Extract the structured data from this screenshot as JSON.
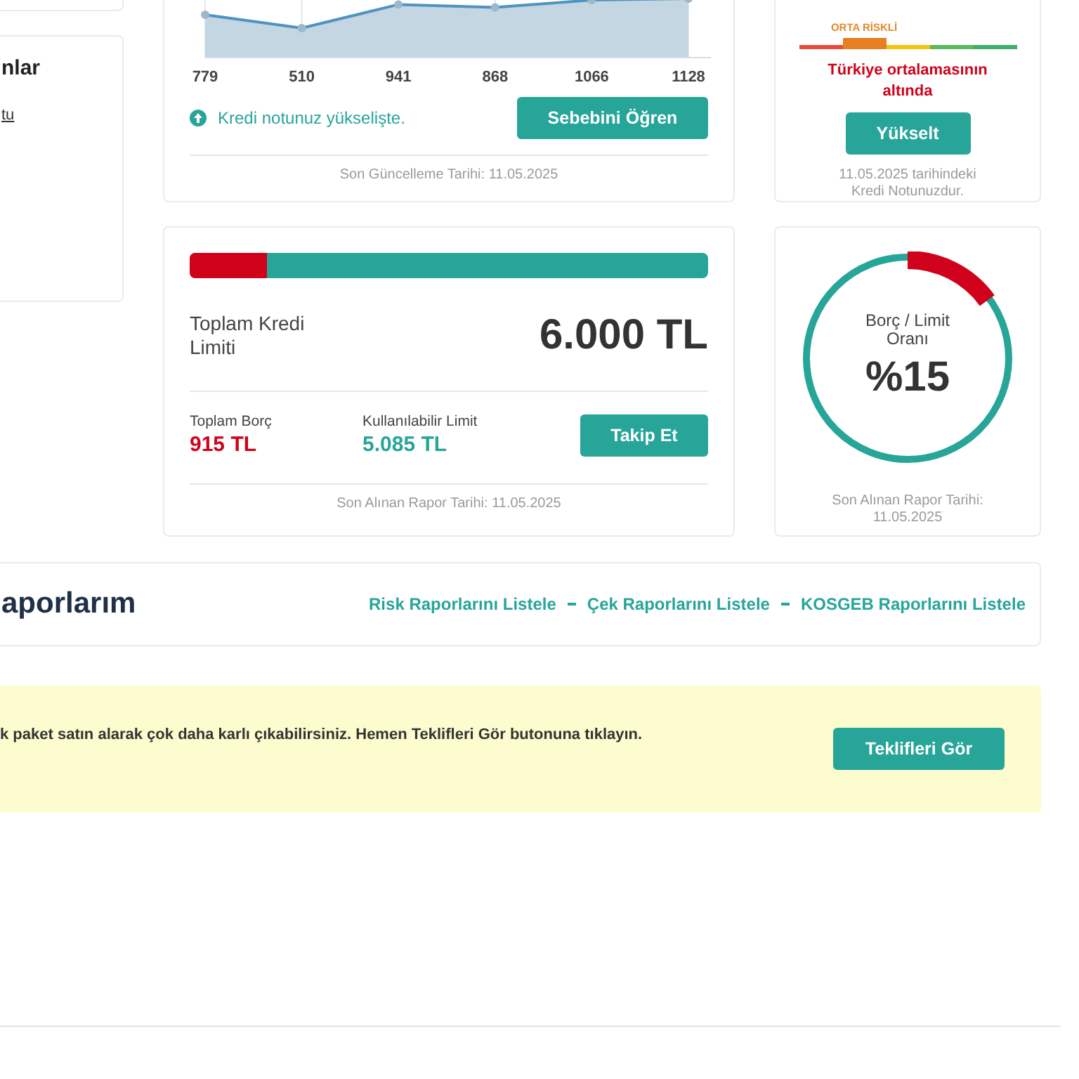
{
  "left_card": {
    "heading": "nlar",
    "link": "tu"
  },
  "score_chart": {
    "point_labels": [
      "779",
      "510",
      "941",
      "868",
      "1066",
      "1128"
    ],
    "trend": "Kredi notunuz yükselişte.",
    "button": "Sebebini Öğren",
    "footer": "Son Güncelleme Tarihi: 11.05.2025"
  },
  "score_card": {
    "risk_label": "ORTA RİSKLİ",
    "segments": [
      {
        "color": "#e74c3c",
        "selected": false
      },
      {
        "color": "#e67e22",
        "selected": true
      },
      {
        "color": "#f1c40f",
        "selected": false
      },
      {
        "color": "#5cb85c",
        "selected": false
      },
      {
        "color": "#3fae6a",
        "selected": false
      }
    ],
    "comparison": "Türkiye ortalamasının altında",
    "button": "Yükselt",
    "footer": "11.05.2025 tarihindeki Kredi Notunuzdur."
  },
  "limit_card": {
    "level": 0.15,
    "title": "Toplam Kredi Limiti",
    "amount": "6.000 TL",
    "debt": {
      "label": "Toplam Borç",
      "value": "915 TL"
    },
    "available": {
      "label": "Kullanılabilir Limit",
      "value": "5.085 TL"
    },
    "button": "Takip Et",
    "footer": "Son Alınan Rapor Tarihi: 11.05.2025"
  },
  "ratio_card": {
    "level": 0.15,
    "label": "Borç / Limit Oranı",
    "value": "%15",
    "footer": "Son Alınan Rapor Tarihi: 11.05.2025"
  },
  "reports": {
    "title": "aporlarım",
    "links": [
      "Risk Raporlarını Listele",
      "Çek Raporlarını Listele",
      "KOSGEB Raporlarını Listele"
    ]
  },
  "banner": {
    "text": "k paket satın alarak çok daha karlı çıkabilirsiniz. Hemen Teklifleri Gör butonuna tıklayın.",
    "button": "Teklifleri Gör"
  }
}
